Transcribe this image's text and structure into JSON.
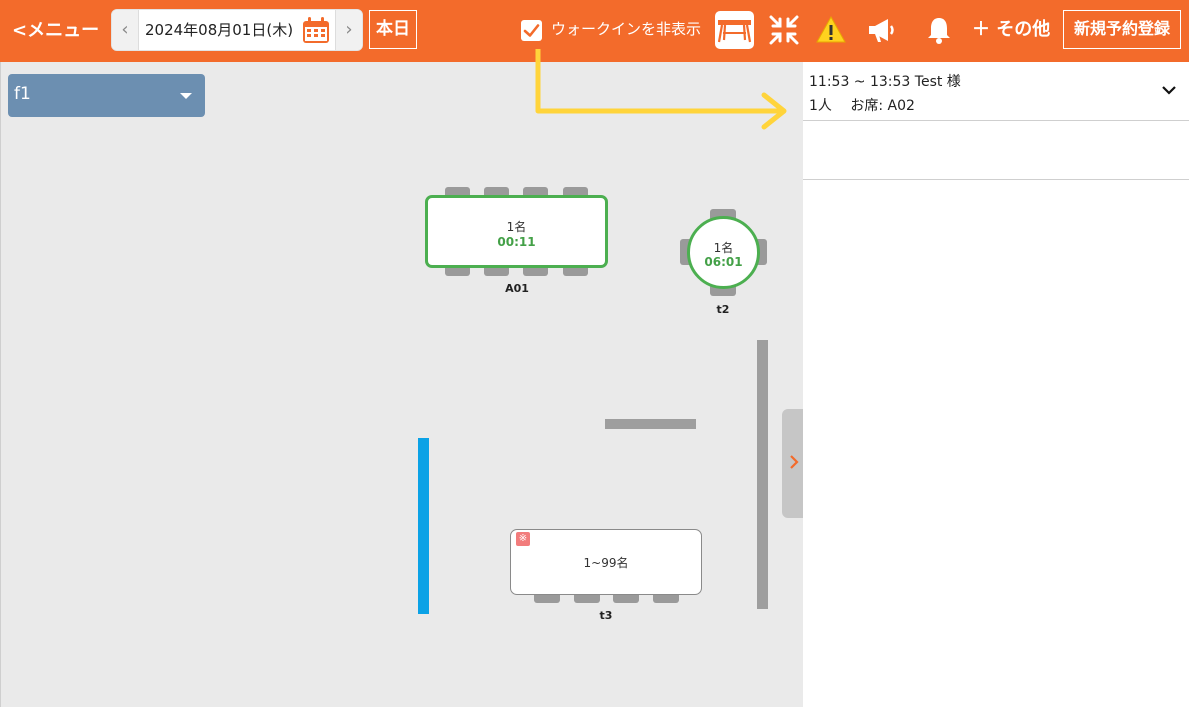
{
  "header": {
    "menu_label": "<メニュー",
    "date_prev_glyph": "‹",
    "date_label": "2024年08月01日(木)",
    "date_next_glyph": "›",
    "today_label": "本日",
    "walkin_hide_label": "ウォークインを非表示",
    "walkin_hide_checked": true,
    "more_label": "＋ その他",
    "new_reservation_label": "新規予約登録",
    "brand_color": "#f36b2b",
    "icons": [
      "calendar-icon",
      "table-view-icon",
      "collapse-icon",
      "warning-icon",
      "megaphone-icon",
      "bell-icon"
    ]
  },
  "floor": {
    "selected": "f1",
    "tables": [
      {
        "name": "A01",
        "count": "1名",
        "time": "00:11",
        "shape": "rect",
        "status_color": "#4caf50"
      },
      {
        "name": "t2",
        "count": "1名",
        "time": "06:01",
        "shape": "round",
        "status_color": "#4caf50"
      },
      {
        "name": "t3",
        "count": "1~99名",
        "shape": "rect",
        "mark": "※"
      }
    ]
  },
  "reservations": [
    {
      "time_range": "11:53 ~ 13:53",
      "guest": "Test 様",
      "party": "1人",
      "seat": "お席: A02"
    }
  ]
}
